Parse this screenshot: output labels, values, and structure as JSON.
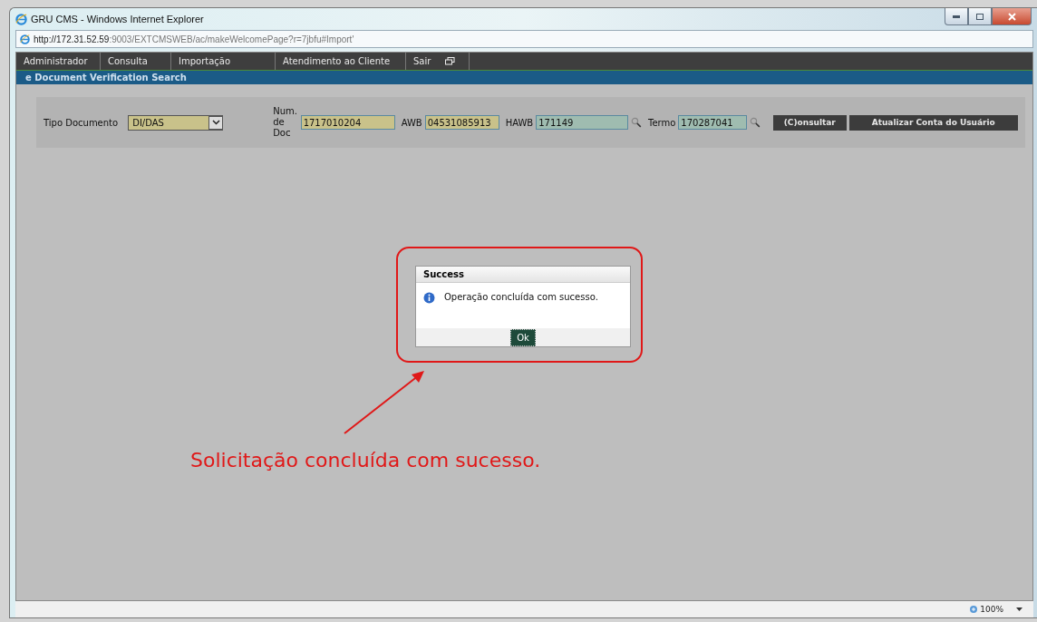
{
  "window": {
    "title": "GRU CMS - Windows Internet Explorer"
  },
  "address_bar": {
    "url_host": "http://172.31.52.59",
    "url_rest": ":9003/EXTCMSWEB/ac/makeWelcomePage?r=7jbfu#Import'"
  },
  "menu": [
    {
      "label": "Administrador"
    },
    {
      "label": "Consulta"
    },
    {
      "label": "Importação"
    },
    {
      "label": "Atendimento ao Cliente"
    },
    {
      "label": "Sair"
    }
  ],
  "page_title": "e Document Verification Search",
  "form": {
    "tipo_label": "Tipo Documento",
    "tipo_value": "DI/DAS",
    "fields": [
      {
        "label": "Num. de Doc",
        "value": "1717010204",
        "kind": "plain"
      },
      {
        "label": "AWB",
        "value": "04531085913",
        "kind": "plain"
      },
      {
        "label": "HAWB",
        "value": "171149",
        "kind": "lookup"
      },
      {
        "label": "Termo",
        "value": "170287041",
        "kind": "lookup"
      }
    ],
    "buttons": [
      "(C)onsultar",
      "Atualizar Conta do Usuário"
    ]
  },
  "dialog": {
    "title": "Success",
    "message": "Operação concluída com sucesso.",
    "button": "Ok"
  },
  "annotation": {
    "caption": "Solicitação concluída com sucesso."
  },
  "status_bar": {
    "zoom": "100%"
  }
}
